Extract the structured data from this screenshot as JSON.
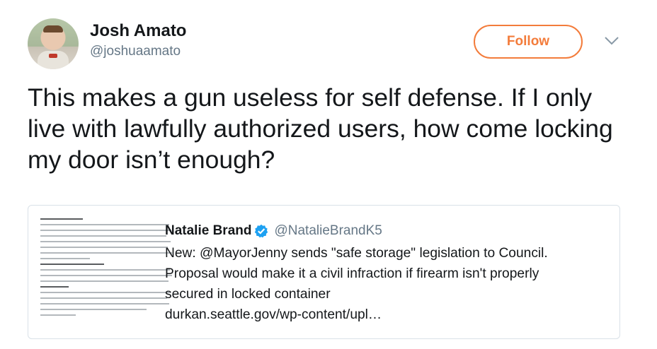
{
  "author": {
    "display_name": "Josh Amato",
    "handle": "@joshuaamato"
  },
  "follow_button": {
    "label": "Follow",
    "accent_color": "#f37c3b"
  },
  "menu_icon": "chevron-down-icon",
  "tweet": {
    "text": "This makes a gun useless for self defense. If I only live with lawfully authorized users, how come locking my door isn’t enough?"
  },
  "quoted_tweet": {
    "author_name": "Natalie Brand",
    "verified": true,
    "verified_color": "#1da1f2",
    "handle": "@NatalieBrandK5",
    "text_lines": [
      "New: @MayorJenny sends \"safe storage\" legislation to Council.",
      "Proposal would make it a civil infraction if firearm isn't properly",
      "secured in locked container",
      "durkan.seattle.gov/wp-content/upl…"
    ]
  }
}
